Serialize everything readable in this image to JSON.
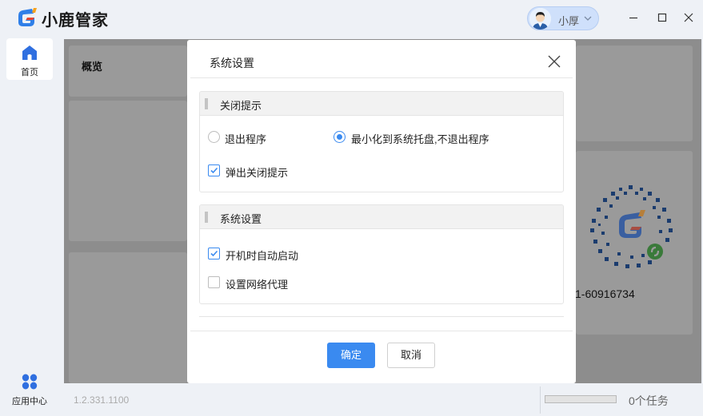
{
  "app": {
    "name": "小鹿管家"
  },
  "user": {
    "name": "小厚"
  },
  "window_controls": [
    "minimize-icon",
    "maximize-icon",
    "close-icon"
  ],
  "sidebar": {
    "items": [
      {
        "label": "首页",
        "icon": "home-icon",
        "active": true
      },
      {
        "label": "应用中心",
        "icon": "apps-grid-icon",
        "active": false
      }
    ]
  },
  "main": {
    "overview_title": "概览",
    "phone_fragment": "1-60916734"
  },
  "statusbar": {
    "version": "1.2.331.1100",
    "progress": 0,
    "tasks": "0个任务"
  },
  "dialog": {
    "title": "系统设置",
    "sections": [
      {
        "title": "关闭提示",
        "options": [
          {
            "type": "radio",
            "label": "退出程序",
            "checked": false
          },
          {
            "type": "radio",
            "label": "最小化到系统托盘,不退出程序",
            "checked": true
          },
          {
            "type": "checkbox",
            "label": "弹出关闭提示",
            "checked": true
          }
        ]
      },
      {
        "title": "系统设置",
        "options": [
          {
            "type": "checkbox",
            "label": "开机时自动启动",
            "checked": true
          },
          {
            "type": "checkbox",
            "label": "设置网络代理",
            "checked": false
          }
        ]
      }
    ],
    "buttons": {
      "ok": "确定",
      "cancel": "取消"
    }
  },
  "colors": {
    "accent": "#3a8af0",
    "overlay": "#8d8d8d",
    "background": "#eef1f6"
  }
}
